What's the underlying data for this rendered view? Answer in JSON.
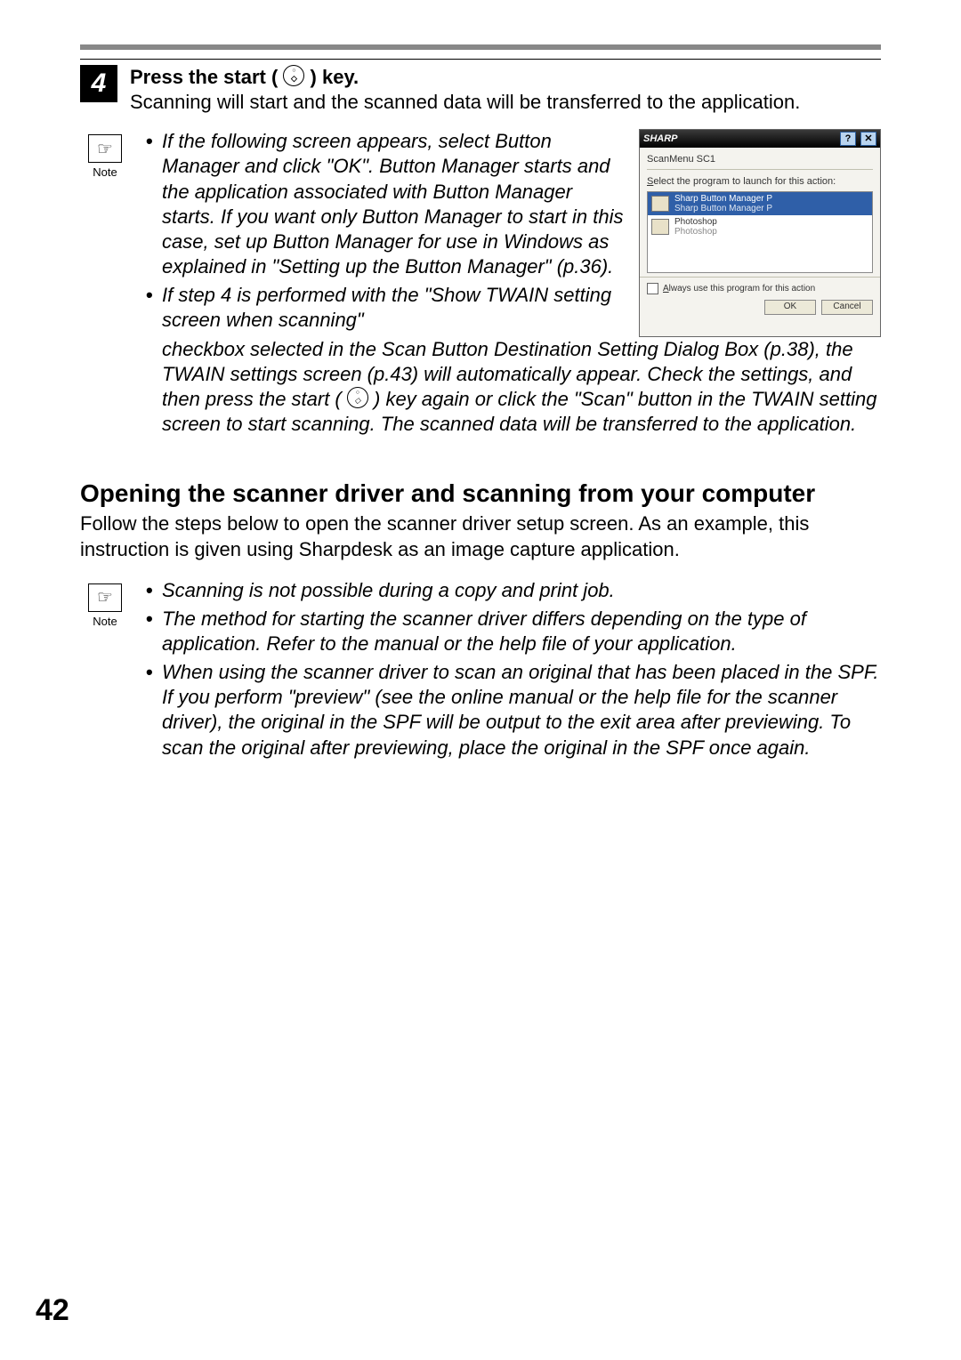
{
  "step": {
    "number": "4",
    "title_pre": "Press the start (",
    "title_post": ") key.",
    "subtitle": "Scanning will start and the scanned data will be transferred to the application."
  },
  "note1": {
    "label": "Note",
    "bullet1a": "If the following screen appears, select Button Manager and click \"OK\". Button Manager starts and the application associated with Button Manager starts. If you want only Button Manager to start in this case, set up Button Manager for use in Windows as explained in \"Setting up the Button Manager\" (p.36).",
    "bullet2a": "If step 4 is performed with the \"Show TWAIN setting screen when scanning\"",
    "bullet2b_pre": "checkbox selected in the Scan Button Destination Setting Dialog Box (p.38), the TWAIN settings screen (p.43) will automatically appear. Check the settings, and then press the start (",
    "bullet2b_post": ") key again or click the \"Scan\" button in the TWAIN setting screen to start scanning. The scanned data will be transferred to the application."
  },
  "dialog": {
    "brand": "SHARP",
    "subtitle": "ScanMenu SC1",
    "prompt_pre": "S",
    "prompt_post": "elect the program to launch for this action:",
    "item1_line1": "Sharp Button Manager P",
    "item1_line2": "Sharp Button Manager P",
    "item2_line1": "Photoshop",
    "item2_line2": "Photoshop",
    "checkbox_pre": "A",
    "checkbox_post": "lways use this program for this action",
    "ok": "OK",
    "cancel": "Cancel"
  },
  "section": {
    "heading": "Opening the scanner driver and scanning from your computer",
    "desc": "Follow the steps below to open the scanner driver setup screen. As an example, this instruction is given using Sharpdesk as an image capture application."
  },
  "note2": {
    "label": "Note",
    "b1": "Scanning is not possible during a copy and print job.",
    "b2": "The method for starting the scanner driver differs depending on the type of application. Refer to the manual or the help file of your application.",
    "b3": "When using the scanner driver to scan an original that has been placed in the SPF. If you perform \"preview\" (see the online manual or the help file for the scanner driver), the original in the SPF will be output to the exit area after previewing. To scan the original after previewing, place the original in the SPF once again."
  },
  "page_number": "42"
}
